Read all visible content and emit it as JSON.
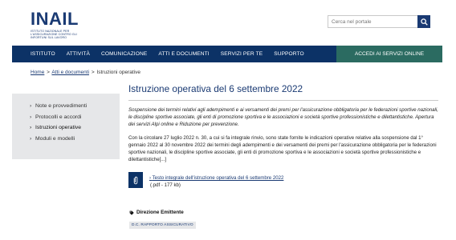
{
  "header": {
    "logo_text": "INAIL",
    "logo_subtitle": "ISTITUTO NAZIONALE PER L'ASSICURAZIONE CONTRO GLI INFORTUNI SUL LAVORO",
    "search_placeholder": "Cerca nel portale"
  },
  "nav": {
    "items": [
      {
        "label": "ISTITUTO"
      },
      {
        "label": "ATTIVITÀ"
      },
      {
        "label": "COMUNICAZIONE"
      },
      {
        "label": "ATTI E DOCUMENTI"
      },
      {
        "label": "SERVIZI PER TE"
      },
      {
        "label": "SUPPORTO"
      }
    ],
    "access_label": "ACCEDI AI SERVIZI ONLINE",
    "access_color": "#2b6b61",
    "bar_color": "#0c3266"
  },
  "breadcrumb": {
    "home": "Home",
    "section": "Atti e documenti",
    "current": "Istruzioni operative",
    "separator": ">"
  },
  "sidebar": {
    "items": [
      {
        "label": "Note e provvedimenti",
        "active": false
      },
      {
        "label": "Protocolli e accordi",
        "active": false
      },
      {
        "label": "Istruzioni operative",
        "active": true
      },
      {
        "label": "Moduli e modelli",
        "active": false
      }
    ],
    "chevron": "›"
  },
  "article": {
    "title": "Istruzione operativa del 6 settembre 2022",
    "abstract": "Sospensione dei termini relativi agli adempimenti e ai versamenti dei premi per l'assicurazione obbligatoria per le federazioni sportive nazionali, le discipline sportive associate, gli enti di promozione sportiva e le associazioni e società sportive professionistiche e dilettantistiche. Apertura dei servizi Alpi online e Riduzione per prevenzione.",
    "body": "Con la circolare 27 luglio 2022 n. 30, a cui si fa integrale rinvio, sono state fornite le indicazioni operative relative alla sospensione dal 1° gennaio 2022 al 30 novembre 2022 dei termini degli adempimenti e dei versamenti dei premi per l'assicurazione obbligatoria per le federazioni sportive nazionali, le discipline sportive associate, gli enti di promozione sportiva e le associazioni e società sportive professionistiche e dilettantistiche[...]"
  },
  "attachment": {
    "link_text": "Testo integrale dell'istruzione operativa del 6 settembre 2022",
    "meta": "(.pdf - 177 kb)",
    "link_prefix": "›"
  },
  "direzione": {
    "heading": "Direzione Emittente",
    "tag": "D.C. RAPPORTO ASSICURATIVO"
  }
}
